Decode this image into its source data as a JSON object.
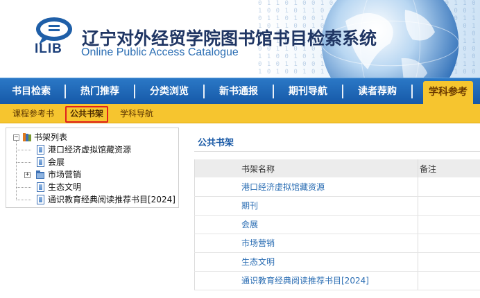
{
  "header": {
    "logo_text": "ILIB",
    "title": "辽宁对外经贸学院图书馆书目检索系统",
    "subtitle": "Online Public Access Catalogue"
  },
  "main_nav": {
    "items": [
      {
        "label": "书目检索"
      },
      {
        "label": "热门推荐"
      },
      {
        "label": "分类浏览"
      },
      {
        "label": "新书通报"
      },
      {
        "label": "期刊导航"
      },
      {
        "label": "读者荐购"
      },
      {
        "label": "学科参考",
        "active": true
      }
    ]
  },
  "sub_nav": {
    "items": [
      {
        "label": "课程参考书"
      },
      {
        "label": "公共书架",
        "active": true
      },
      {
        "label": "学科导航"
      }
    ]
  },
  "tree": {
    "root": {
      "label": "书架列表",
      "toggle": "−"
    },
    "items": [
      {
        "label": "港口经济虚拟馆藏资源"
      },
      {
        "label": "会展"
      },
      {
        "label": "市场营销",
        "toggle": "+"
      },
      {
        "label": "生态文明"
      },
      {
        "label": "通识教育经典阅读推荐书目[2024]"
      }
    ]
  },
  "content": {
    "title": "公共书架",
    "table": {
      "columns": [
        "书架名称",
        "备注"
      ],
      "rows": [
        {
          "name": "港口经济虚拟馆藏资源",
          "note": ""
        },
        {
          "name": "期刊",
          "note": ""
        },
        {
          "name": "会展",
          "note": ""
        },
        {
          "name": "市场营销",
          "note": ""
        },
        {
          "name": "生态文明",
          "note": ""
        },
        {
          "name": "通识教育经典阅读推荐书目[2024]",
          "note": ""
        }
      ]
    }
  },
  "colors": {
    "nav_blue": "#1d65b5",
    "nav_active": "#f6c52f",
    "link_blue": "#2a6db3",
    "highlight_red": "#e0201e"
  }
}
